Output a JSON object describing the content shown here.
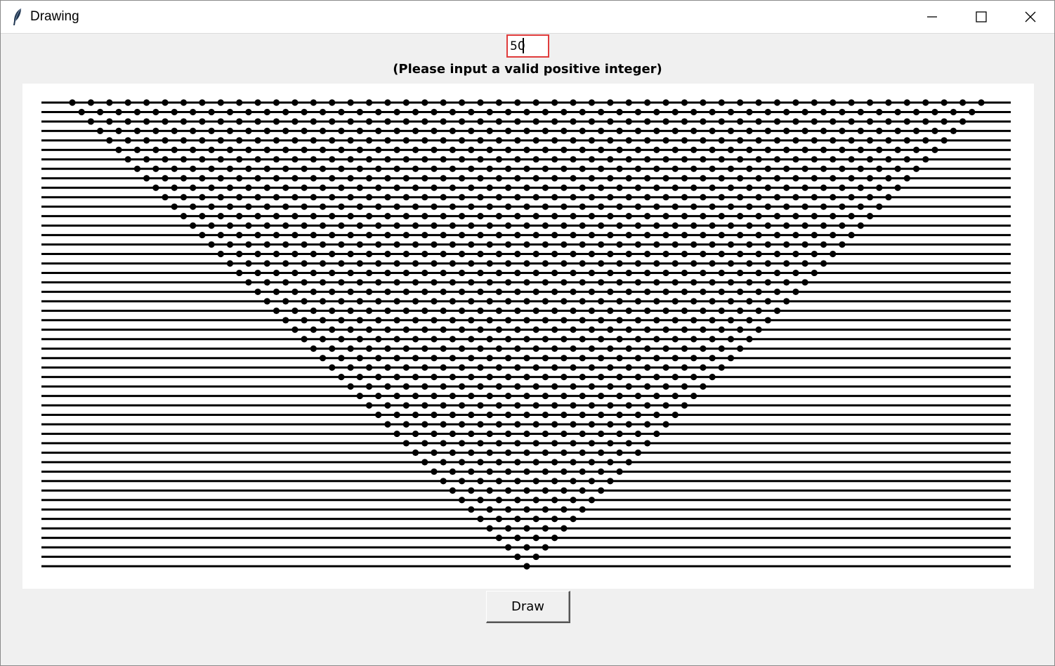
{
  "window": {
    "title": "Drawing",
    "app_icon": "feather-icon",
    "controls": [
      "minimize-icon",
      "maximize-icon",
      "close-icon"
    ]
  },
  "input": {
    "value": "50",
    "border_color": "#e03c3c"
  },
  "hint_text": "(Please input a valid positive integer)",
  "drawing": {
    "line_count": 50,
    "line_color": "#000000",
    "node_color": "#000000",
    "background": "#ffffff"
  },
  "draw_button": {
    "label": "Draw"
  }
}
